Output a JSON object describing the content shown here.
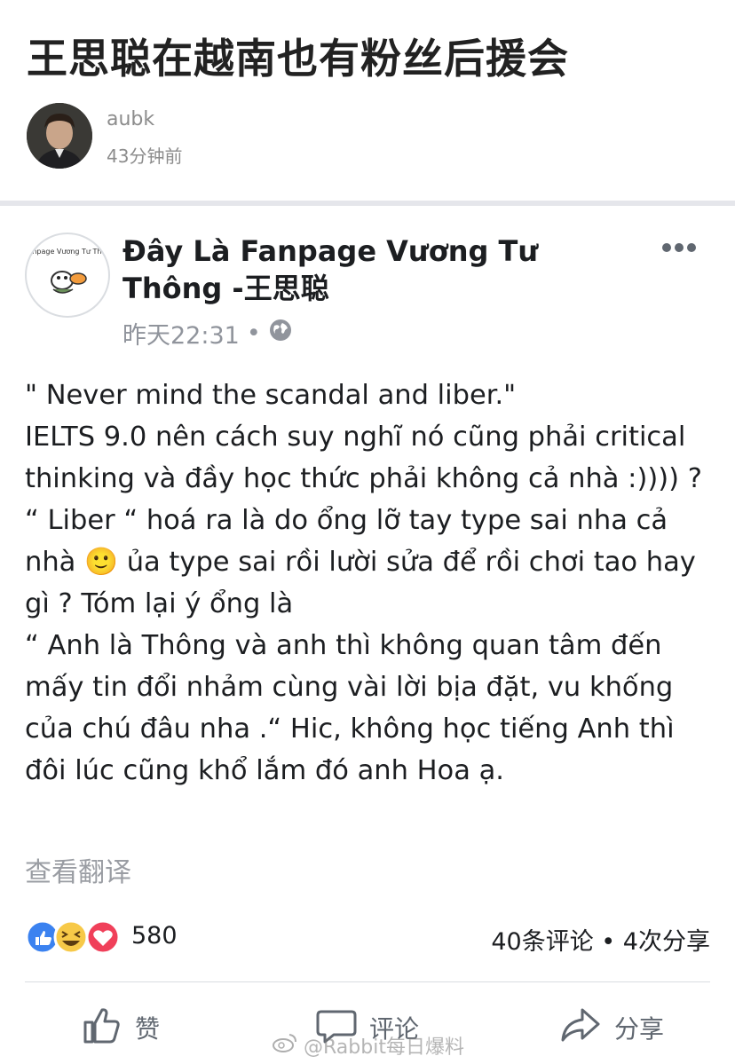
{
  "article": {
    "title": "王思聪在越南也有粉丝后援会",
    "author": "aubk",
    "time": "43分钟前"
  },
  "post": {
    "page_name": "Đây Là Fanpage Vương Tư Thông -王思聪",
    "avatar_text": "Fanpage Vương Tư Thông",
    "time": "昨天22:31",
    "separator": "•",
    "visibility_icon": "globe-icon",
    "body": "\" Never mind the scandal and liber.\"\nIELTS 9.0 nên cách suy nghĩ nó cũng phải critical thinking và đầy học thức phải không cả nhà :)))) ?\n“ Liber “ hoá ra là do ổng lỡ tay type sai nha cả nhà 🙂 ủa type sai rồi lười sửa để rồi chơi tao hay gì ? Tóm lại ý ổng là\n“ Anh là Thông và anh thì không quan tâm đến mấy tin đổi nhảm cùng vài lời bịa đặt, vu khống của chú đâu nha .“ Hic, không học tiếng Anh thì đôi lúc cũng khổ lắm đó anh Hoa ạ.",
    "translate_label": "查看翻译"
  },
  "stats": {
    "reaction_count": "580",
    "summary": "40条评论 • 4次分享"
  },
  "actions": {
    "like": "赞",
    "comment": "评论",
    "share": "分享"
  },
  "watermark": "@Rabbit每日爆料",
  "colors": {
    "like_blue": "#3b82f0",
    "haha_yellow": "#f7c948",
    "love_red": "#f0405a",
    "meta_gray": "#90949c"
  }
}
